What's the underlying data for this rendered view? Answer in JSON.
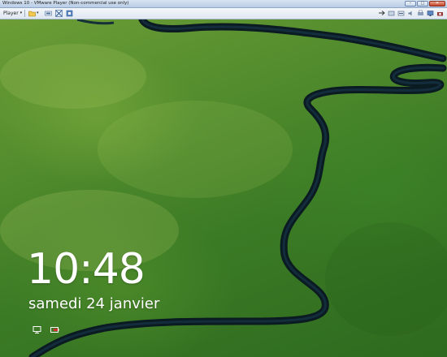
{
  "window": {
    "title": "Windows 10 - VMware Player (Non-commercial use only)"
  },
  "toolbar": {
    "player_label": "Player",
    "icons": [
      "folder-icon",
      "send-ctrl-alt-del-icon",
      "fullscreen-icon",
      "unity-icon"
    ],
    "device_icons": [
      "network-icon",
      "usb-icon",
      "cd-icon",
      "sound-icon",
      "printer-icon",
      "display-icon",
      "camera-icon"
    ]
  },
  "lockscreen": {
    "time": "10:48",
    "date": "samedi 24 janvier",
    "status_icons": [
      "network-status-icon",
      "battery-status-icon"
    ]
  },
  "colors": {
    "grass": "#4f8a2c",
    "river": "#0c1d24",
    "text": "#ffffff"
  }
}
